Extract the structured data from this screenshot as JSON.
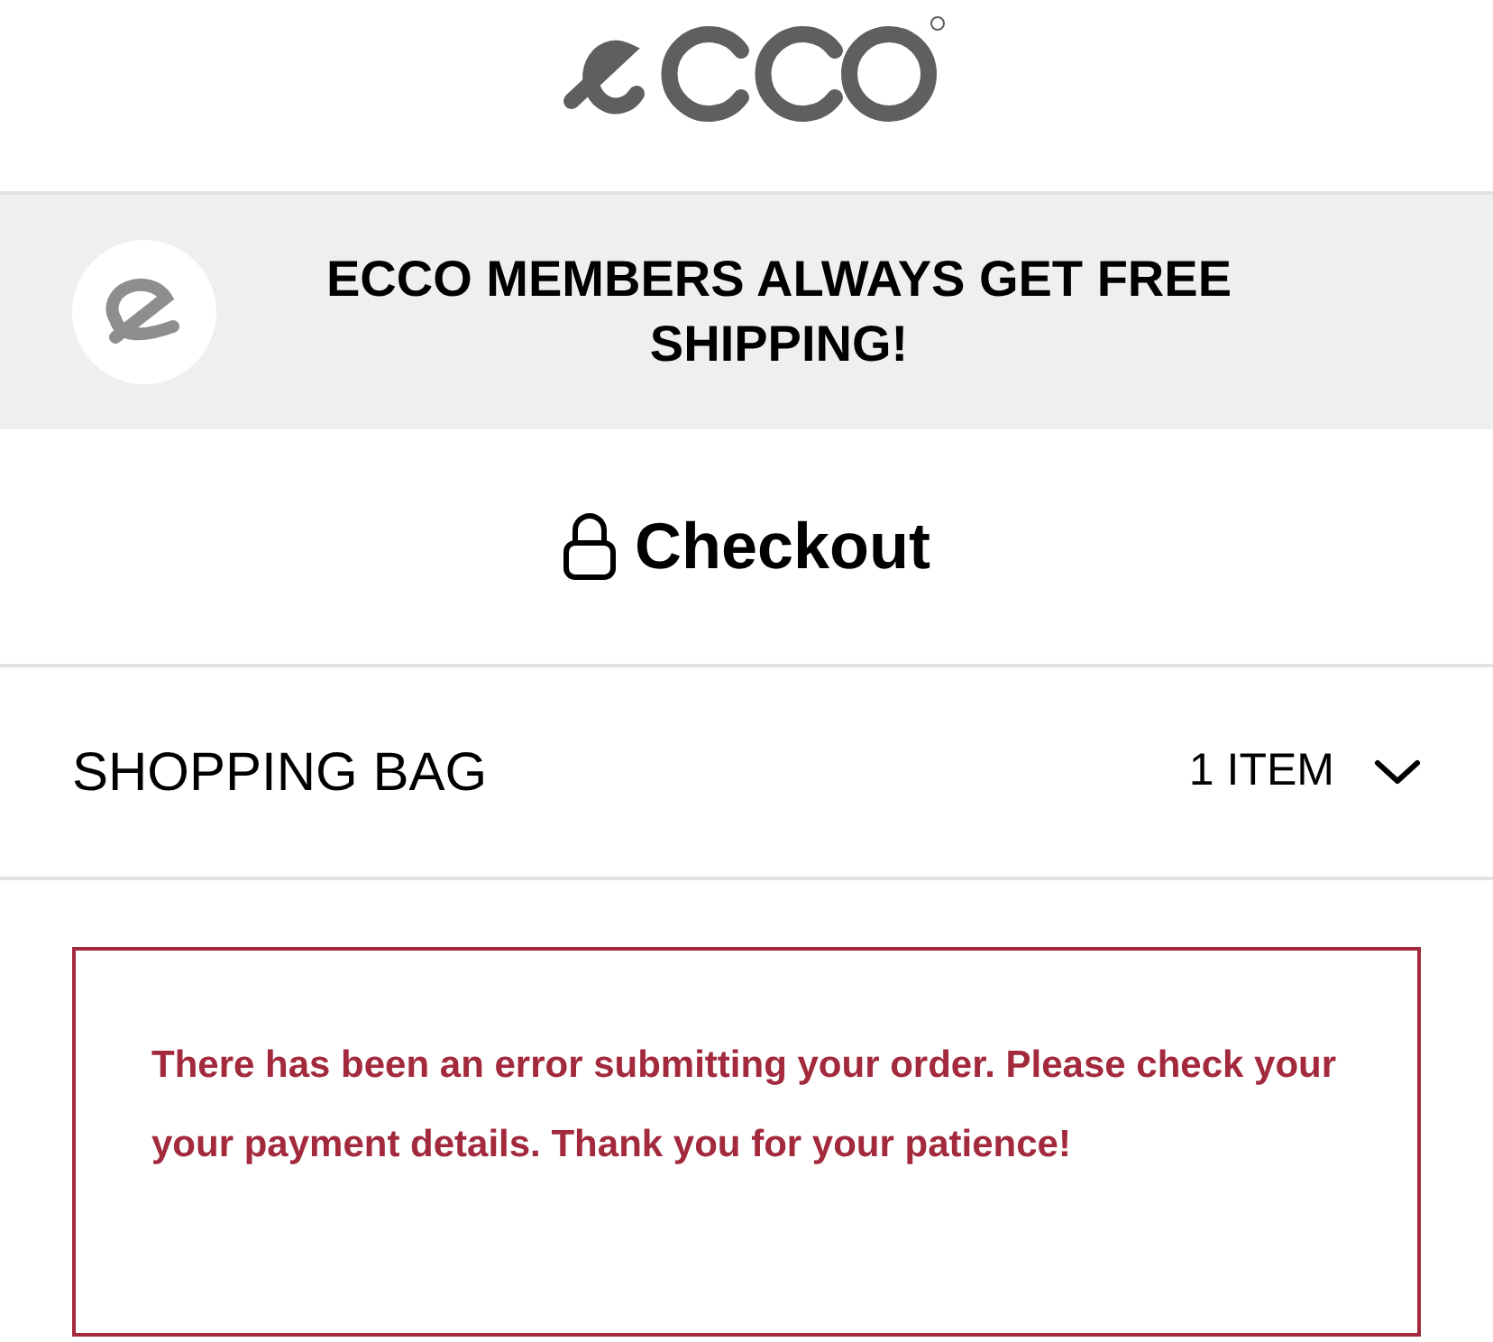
{
  "banner": {
    "text": "ECCO MEMBERS ALWAYS GET FREE SHIPPING!"
  },
  "checkout": {
    "title": "Checkout"
  },
  "shopping_bag": {
    "title": "SHOPPING BAG",
    "count": "1 ITEM",
    "expanded": false
  },
  "error": {
    "message": "There has been an error submitting your order. Please check your your payment details. Thank you for your patience!"
  }
}
